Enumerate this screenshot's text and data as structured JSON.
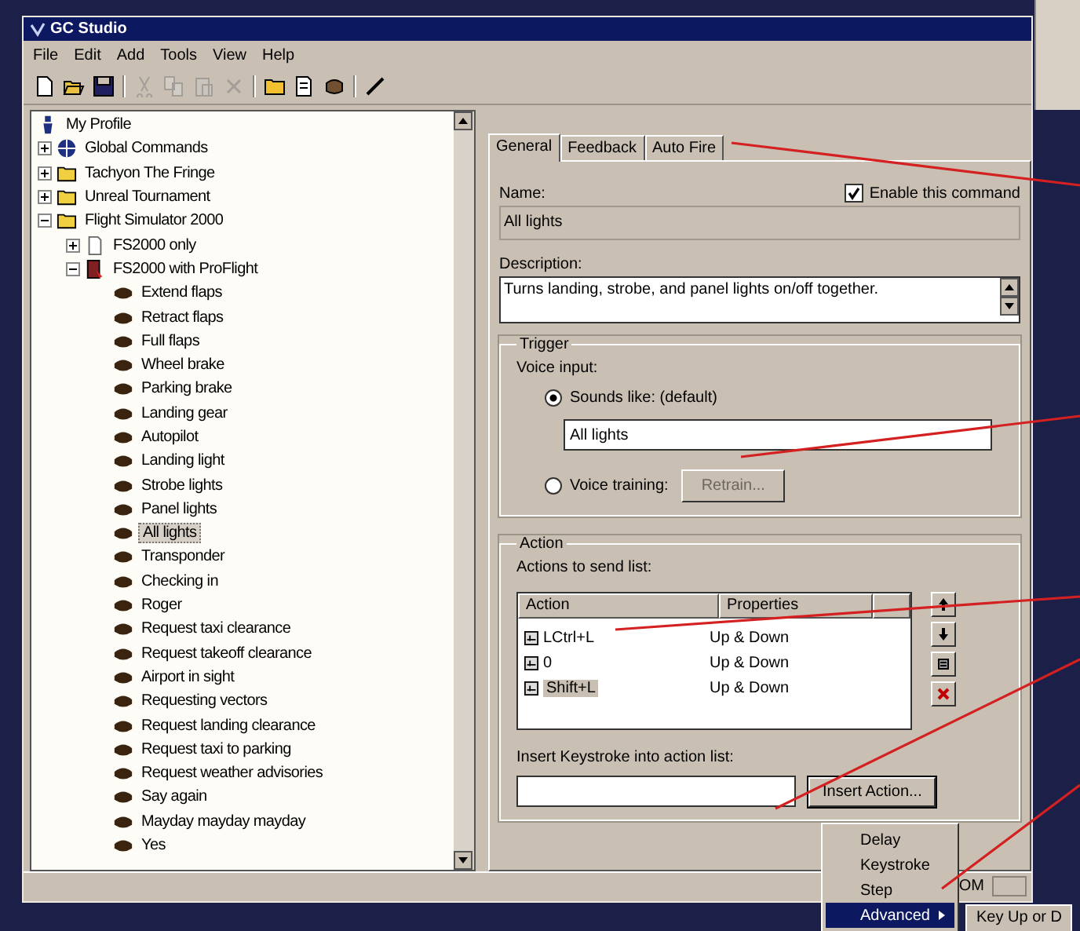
{
  "window": {
    "title": "GC Studio"
  },
  "menu": [
    "File",
    "Edit",
    "Add",
    "Tools",
    "View",
    "Help"
  ],
  "toolbar": [
    {
      "kind": "new",
      "disabled": false
    },
    {
      "kind": "open",
      "disabled": false
    },
    {
      "kind": "save",
      "disabled": false
    },
    {
      "kind": "sep"
    },
    {
      "kind": "cut",
      "disabled": true
    },
    {
      "kind": "copy",
      "disabled": true
    },
    {
      "kind": "paste",
      "disabled": true
    },
    {
      "kind": "delete",
      "disabled": true
    },
    {
      "kind": "sep"
    },
    {
      "kind": "folder",
      "disabled": false
    },
    {
      "kind": "doc",
      "disabled": false
    },
    {
      "kind": "command",
      "disabled": false
    },
    {
      "kind": "sep"
    },
    {
      "kind": "mic",
      "disabled": false
    }
  ],
  "tree": [
    {
      "label": "My Profile",
      "kind": "profile",
      "selected": false,
      "children": [
        {
          "label": "Global Commands",
          "kind": "globe",
          "expanded": false,
          "selected": false
        },
        {
          "label": "Tachyon The Fringe",
          "kind": "folder",
          "expanded": false,
          "selected": false
        },
        {
          "label": "Unreal Tournament",
          "kind": "folder",
          "expanded": false,
          "selected": false
        },
        {
          "label": "Flight Simulator 2000",
          "kind": "folder",
          "expanded": true,
          "selected": false,
          "children": [
            {
              "label": "FS2000 only",
              "kind": "doc",
              "expanded": false,
              "selected": false
            },
            {
              "label": "FS2000 with ProFlight",
              "kind": "set",
              "expanded": true,
              "selected": false,
              "children": [
                {
                  "label": "Extend flaps",
                  "kind": "command",
                  "selected": false
                },
                {
                  "label": "Retract flaps",
                  "kind": "command",
                  "selected": false
                },
                {
                  "label": "Full flaps",
                  "kind": "command",
                  "selected": false
                },
                {
                  "label": "Wheel brake",
                  "kind": "command",
                  "selected": false
                },
                {
                  "label": "Parking brake",
                  "kind": "command",
                  "selected": false
                },
                {
                  "label": "Landing gear",
                  "kind": "command",
                  "selected": false
                },
                {
                  "label": "Autopilot",
                  "kind": "command",
                  "selected": false
                },
                {
                  "label": "Landing light",
                  "kind": "command",
                  "selected": false
                },
                {
                  "label": "Strobe lights",
                  "kind": "command",
                  "selected": false
                },
                {
                  "label": "Panel lights",
                  "kind": "command",
                  "selected": false
                },
                {
                  "label": "All lights",
                  "kind": "command",
                  "selected": true
                },
                {
                  "label": "Transponder",
                  "kind": "command",
                  "selected": false
                },
                {
                  "label": "Checking in",
                  "kind": "command",
                  "selected": false
                },
                {
                  "label": "Roger",
                  "kind": "command",
                  "selected": false
                },
                {
                  "label": "Request taxi clearance",
                  "kind": "command",
                  "selected": false
                },
                {
                  "label": "Request takeoff clearance",
                  "kind": "command",
                  "selected": false
                },
                {
                  "label": "Airport in sight",
                  "kind": "command",
                  "selected": false
                },
                {
                  "label": "Requesting vectors",
                  "kind": "command",
                  "selected": false
                },
                {
                  "label": "Request landing clearance",
                  "kind": "command",
                  "selected": false
                },
                {
                  "label": "Request taxi to parking",
                  "kind": "command",
                  "selected": false
                },
                {
                  "label": "Request weather advisories",
                  "kind": "command",
                  "selected": false
                },
                {
                  "label": "Say again",
                  "kind": "command",
                  "selected": false
                },
                {
                  "label": "Mayday mayday mayday",
                  "kind": "command",
                  "selected": false
                },
                {
                  "label": "Yes",
                  "kind": "command",
                  "selected": false
                }
              ]
            }
          ]
        }
      ]
    }
  ],
  "tabs": [
    {
      "label": "General",
      "selected": true
    },
    {
      "label": "Feedback",
      "selected": false
    },
    {
      "label": "Auto Fire",
      "selected": false
    }
  ],
  "name": {
    "label": "Name:",
    "value": "All lights"
  },
  "enable": {
    "label": "Enable this command",
    "checked": true
  },
  "description": {
    "label": "Description:",
    "value": "Turns landing, strobe, and panel lights on/off together."
  },
  "trigger": {
    "title": "Trigger",
    "voice_input": "Voice input:",
    "options": [
      {
        "label": "Sounds like: (default)",
        "selected": true
      },
      {
        "label": "Voice training:",
        "selected": false
      }
    ],
    "sounds_like": "All lights",
    "retrain": {
      "label": "Retrain...",
      "disabled": true
    }
  },
  "action": {
    "title": "Action",
    "list_label": "Actions to send list:",
    "columns": [
      "Action",
      "Properties"
    ],
    "rows": [
      {
        "action": "LCtrl+L",
        "properties": "Up & Down",
        "selected": false
      },
      {
        "action": "0",
        "properties": "Up & Down",
        "selected": false
      },
      {
        "action": "Shift+L",
        "properties": "Up & Down",
        "selected": true
      }
    ],
    "side_buttons": [
      {
        "kind": "up"
      },
      {
        "kind": "down"
      },
      {
        "kind": "edit"
      },
      {
        "kind": "delete"
      }
    ],
    "insert_label": "Insert Keystroke into action list:",
    "insert_button": "Insert Action..."
  },
  "popup_menu": [
    {
      "label": "Delay",
      "selected": false,
      "submenu": false
    },
    {
      "label": "Keystroke",
      "selected": false,
      "submenu": false
    },
    {
      "label": "Step",
      "selected": false,
      "submenu": false
    },
    {
      "label": "Advanced",
      "selected": true,
      "submenu": true
    }
  ],
  "submenu": [
    "Key Up or D"
  ],
  "status_bar": {
    "text": "OM"
  }
}
